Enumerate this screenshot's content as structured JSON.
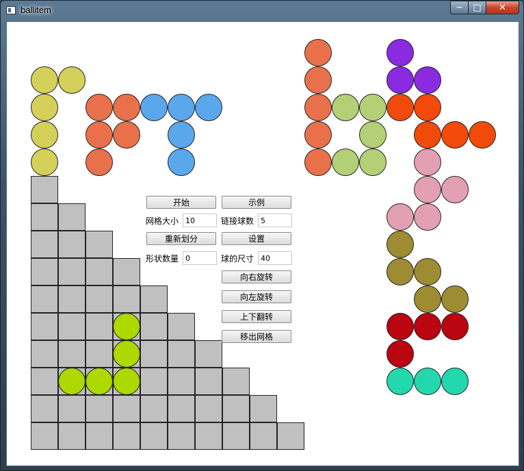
{
  "window": {
    "title": "ballitem"
  },
  "colors": {
    "yellow": "#d4d05a",
    "orange": "#e8714c",
    "blue": "#5aa7ec",
    "purple": "#8a2be2",
    "light_green": "#b3d077",
    "red_orange": "#f24a0a",
    "pink": "#e3a0b4",
    "olive": "#9e8c32",
    "dark_red": "#bb0510",
    "teal": "#24d8ae",
    "lime": "#add800",
    "grid_gray": "#c0c0c0"
  },
  "controls": {
    "start_label": "开始",
    "example_label": "示例",
    "grid_size_label": "网格大小",
    "grid_size_value": "10",
    "link_count_label": "链接球数",
    "link_count_value": "5",
    "repartition_label": "重新划分",
    "settings_label": "设置",
    "shape_count_label": "形状数量",
    "shape_count_value": "0",
    "ball_size_label": "球的尺寸",
    "ball_size_value": "40",
    "rotate_right_label": "向右旋转",
    "rotate_left_label": "向左旋转",
    "flip_label": "上下翻转",
    "remove_label": "移出网格"
  },
  "grid": {
    "size": 10,
    "filled_rows": [
      1,
      2,
      3,
      4,
      5,
      6,
      7,
      8,
      9,
      10
    ]
  },
  "pieces": [
    {
      "name": "yellow-piece",
      "color": "yellow",
      "cells": [
        [
          0,
          1
        ],
        [
          1,
          1
        ],
        [
          0,
          2
        ],
        [
          0,
          3
        ],
        [
          0,
          4
        ]
      ]
    },
    {
      "name": "orange-left-piece",
      "color": "orange",
      "cells": [
        [
          2,
          2
        ],
        [
          3,
          2
        ],
        [
          2,
          3
        ],
        [
          3,
          3
        ],
        [
          2,
          4
        ]
      ]
    },
    {
      "name": "blue-piece",
      "color": "blue",
      "cells": [
        [
          4,
          2
        ],
        [
          5,
          2
        ],
        [
          6,
          2
        ],
        [
          5,
          3
        ],
        [
          5,
          4
        ]
      ]
    },
    {
      "name": "orange-right-piece",
      "color": "orange",
      "cells": [
        [
          10,
          0
        ],
        [
          10,
          1
        ],
        [
          10,
          2
        ],
        [
          10,
          3
        ],
        [
          10,
          4
        ]
      ]
    },
    {
      "name": "light-green-piece",
      "color": "light_green",
      "cells": [
        [
          11,
          2
        ],
        [
          12,
          2
        ],
        [
          12,
          3
        ],
        [
          11,
          4
        ],
        [
          12,
          4
        ]
      ]
    },
    {
      "name": "purple-piece",
      "color": "purple",
      "cells": [
        [
          13,
          0
        ],
        [
          13,
          1
        ],
        [
          14,
          1
        ]
      ]
    },
    {
      "name": "red-orange-piece",
      "color": "red_orange",
      "cells": [
        [
          13,
          2
        ],
        [
          14,
          2
        ],
        [
          14,
          3
        ],
        [
          15,
          3
        ],
        [
          16,
          3
        ]
      ]
    },
    {
      "name": "pink-piece",
      "color": "pink",
      "cells": [
        [
          14,
          4
        ],
        [
          14,
          5
        ],
        [
          15,
          5
        ],
        [
          13,
          6
        ],
        [
          14,
          6
        ]
      ]
    },
    {
      "name": "olive-piece",
      "color": "olive",
      "cells": [
        [
          13,
          7
        ],
        [
          13,
          8
        ],
        [
          14,
          8
        ],
        [
          14,
          9
        ],
        [
          15,
          9
        ]
      ]
    },
    {
      "name": "dark-red-piece",
      "color": "dark_red",
      "cells": [
        [
          13,
          10
        ],
        [
          14,
          10
        ],
        [
          15,
          10
        ],
        [
          13,
          11
        ]
      ]
    },
    {
      "name": "teal-piece",
      "color": "teal",
      "cells": [
        [
          13,
          12
        ],
        [
          14,
          12
        ],
        [
          15,
          12
        ]
      ]
    },
    {
      "name": "lime-piece-in-grid",
      "color": "lime",
      "cells": [
        [
          3,
          10
        ],
        [
          3,
          11
        ],
        [
          1,
          12
        ],
        [
          2,
          12
        ],
        [
          3,
          12
        ]
      ]
    }
  ]
}
